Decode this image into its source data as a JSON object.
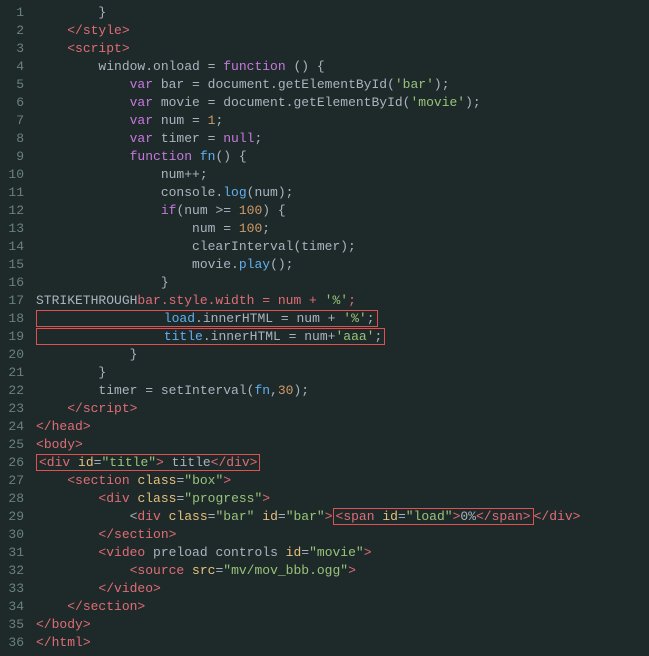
{
  "lines": [
    {
      "num": 1,
      "tokens": [
        {
          "t": "        }",
          "c": "plain"
        }
      ]
    },
    {
      "num": 2,
      "tokens": [
        {
          "t": "    </",
          "c": "tag"
        },
        {
          "t": "style",
          "c": "tag"
        },
        {
          "t": ">",
          "c": "tag"
        }
      ]
    },
    {
      "num": 3,
      "tokens": [
        {
          "t": "    <",
          "c": "tag"
        },
        {
          "t": "script",
          "c": "tag"
        },
        {
          "t": ">",
          "c": "tag"
        }
      ]
    },
    {
      "num": 4,
      "tokens": [
        {
          "t": "        window.onload = ",
          "c": "plain"
        },
        {
          "t": "function",
          "c": "purple"
        },
        {
          "t": " () {",
          "c": "plain"
        }
      ]
    },
    {
      "num": 5,
      "tokens": [
        {
          "t": "            ",
          "c": "plain"
        },
        {
          "t": "var",
          "c": "purple"
        },
        {
          "t": " bar = document.getElementById(",
          "c": "plain"
        },
        {
          "t": "'bar'",
          "c": "str"
        },
        {
          "t": ");",
          "c": "plain"
        }
      ]
    },
    {
      "num": 6,
      "tokens": [
        {
          "t": "            ",
          "c": "plain"
        },
        {
          "t": "var",
          "c": "purple"
        },
        {
          "t": " movie = document.getElementById(",
          "c": "plain"
        },
        {
          "t": "'movie'",
          "c": "str"
        },
        {
          "t": ");",
          "c": "plain"
        }
      ]
    },
    {
      "num": 7,
      "tokens": [
        {
          "t": "            ",
          "c": "plain"
        },
        {
          "t": "var",
          "c": "purple"
        },
        {
          "t": " num = ",
          "c": "plain"
        },
        {
          "t": "1",
          "c": "num"
        },
        {
          "t": ";",
          "c": "plain"
        }
      ]
    },
    {
      "num": 8,
      "tokens": [
        {
          "t": "            ",
          "c": "plain"
        },
        {
          "t": "var",
          "c": "purple"
        },
        {
          "t": " timer = ",
          "c": "plain"
        },
        {
          "t": "null",
          "c": "purple"
        },
        {
          "t": ";",
          "c": "plain"
        }
      ]
    },
    {
      "num": 9,
      "tokens": [
        {
          "t": "            ",
          "c": "plain"
        },
        {
          "t": "function",
          "c": "purple"
        },
        {
          "t": " ",
          "c": "plain"
        },
        {
          "t": "fn",
          "c": "blue"
        },
        {
          "t": "() {",
          "c": "plain"
        }
      ]
    },
    {
      "num": 10,
      "tokens": [
        {
          "t": "                num++;",
          "c": "plain"
        }
      ]
    },
    {
      "num": 11,
      "tokens": [
        {
          "t": "                console.",
          "c": "plain"
        },
        {
          "t": "log",
          "c": "blue"
        },
        {
          "t": "(num);",
          "c": "plain"
        }
      ]
    },
    {
      "num": 12,
      "tokens": [
        {
          "t": "                ",
          "c": "plain"
        },
        {
          "t": "if",
          "c": "purple"
        },
        {
          "t": "(num >= ",
          "c": "plain"
        },
        {
          "t": "100",
          "c": "num"
        },
        {
          "t": ") {",
          "c": "plain"
        }
      ]
    },
    {
      "num": 13,
      "tokens": [
        {
          "t": "                    num = ",
          "c": "plain"
        },
        {
          "t": "100",
          "c": "num"
        },
        {
          "t": ";",
          "c": "plain"
        }
      ]
    },
    {
      "num": 14,
      "tokens": [
        {
          "t": "                    clearInterval(timer);",
          "c": "plain"
        }
      ]
    },
    {
      "num": 15,
      "tokens": [
        {
          "t": "                    movie.",
          "c": "plain"
        },
        {
          "t": "play",
          "c": "blue"
        },
        {
          "t": "();",
          "c": "plain"
        }
      ]
    },
    {
      "num": 16,
      "tokens": [
        {
          "t": "                }",
          "c": "plain"
        }
      ]
    },
    {
      "num": 17,
      "tokens": [
        {
          "t": "STRIKETHROUGH",
          "c": "strike"
        },
        {
          "t": "bar.style.width = num + ",
          "c": "red2"
        },
        {
          "t": "'%'",
          "c": "str2"
        },
        {
          "t": ";",
          "c": "red2"
        }
      ]
    },
    {
      "num": 18,
      "tokens": [
        {
          "t": "HIGHLIGHT",
          "c": "highlight"
        },
        {
          "t": "load",
          "c": "hl_load"
        },
        {
          "t": ".innerHTML = num + ",
          "c": "hl_plain"
        },
        {
          "t": "'%'",
          "c": "hl_str"
        },
        {
          "t": ";",
          "c": "hl_plain"
        }
      ]
    },
    {
      "num": 19,
      "tokens": [
        {
          "t": "HIGHLIGHT",
          "c": "highlight"
        },
        {
          "t": "title",
          "c": "hl_title"
        },
        {
          "t": ".innerHTML = num+",
          "c": "hl_plain"
        },
        {
          "t": "'aaa'",
          "c": "hl_str"
        },
        {
          "t": ";",
          "c": "hl_plain"
        }
      ]
    },
    {
      "num": 20,
      "tokens": [
        {
          "t": "            }",
          "c": "plain"
        }
      ]
    },
    {
      "num": 21,
      "tokens": [
        {
          "t": "        }",
          "c": "plain"
        }
      ]
    },
    {
      "num": 22,
      "tokens": [
        {
          "t": "        timer = setInterval(",
          "c": "plain"
        },
        {
          "t": "fn",
          "c": "blue"
        },
        {
          "t": ",",
          "c": "plain"
        },
        {
          "t": "30",
          "c": "num"
        },
        {
          "t": ");",
          "c": "plain"
        }
      ]
    },
    {
      "num": 23,
      "tokens": [
        {
          "t": "    </",
          "c": "tag"
        },
        {
          "t": "script",
          "c": "tag"
        },
        {
          "t": ">",
          "c": "tag"
        }
      ]
    },
    {
      "num": 24,
      "tokens": [
        {
          "t": "</",
          "c": "tag"
        },
        {
          "t": "head",
          "c": "tag"
        },
        {
          "t": ">",
          "c": "tag"
        }
      ]
    },
    {
      "num": 25,
      "tokens": [
        {
          "t": "<",
          "c": "tag"
        },
        {
          "t": "body",
          "c": "tag"
        },
        {
          "t": ">",
          "c": "tag"
        }
      ]
    },
    {
      "num": 26,
      "tokens": [
        {
          "t": "TITLE_HL",
          "c": "title_hl"
        }
      ]
    },
    {
      "num": 27,
      "tokens": [
        {
          "t": "    <",
          "c": "tag"
        },
        {
          "t": "section",
          "c": "tag"
        },
        {
          "t": " ",
          "c": "plain"
        },
        {
          "t": "class",
          "c": "attr"
        },
        {
          "t": "=",
          "c": "plain"
        },
        {
          "t": "\"box\"",
          "c": "str"
        },
        {
          "t": ">",
          "c": "tag"
        }
      ]
    },
    {
      "num": 28,
      "tokens": [
        {
          "t": "        <",
          "c": "tag"
        },
        {
          "t": "div",
          "c": "tag"
        },
        {
          "t": " ",
          "c": "plain"
        },
        {
          "t": "class",
          "c": "attr"
        },
        {
          "t": "=",
          "c": "plain"
        },
        {
          "t": "\"progress\"",
          "c": "str"
        },
        {
          "t": ">",
          "c": "tag"
        }
      ]
    },
    {
      "num": 29,
      "tokens": [
        {
          "t": "LOAD_HL",
          "c": "load_hl"
        }
      ]
    },
    {
      "num": 30,
      "tokens": [
        {
          "t": "        </",
          "c": "tag"
        },
        {
          "t": "section",
          "c": "tag"
        },
        {
          "t": ">",
          "c": "tag"
        }
      ]
    },
    {
      "num": 31,
      "tokens": [
        {
          "t": "        <",
          "c": "tag"
        },
        {
          "t": "video",
          "c": "tag"
        },
        {
          "t": " ",
          "c": "plain"
        },
        {
          "t": "preload controls ",
          "c": "plain"
        },
        {
          "t": "id",
          "c": "attr"
        },
        {
          "t": "=",
          "c": "plain"
        },
        {
          "t": "\"movie\"",
          "c": "str"
        },
        {
          "t": ">",
          "c": "tag"
        }
      ]
    },
    {
      "num": 32,
      "tokens": [
        {
          "t": "            <",
          "c": "tag"
        },
        {
          "t": "source",
          "c": "tag"
        },
        {
          "t": " ",
          "c": "plain"
        },
        {
          "t": "src",
          "c": "attr"
        },
        {
          "t": "=",
          "c": "plain"
        },
        {
          "t": "\"mv/mov_bbb.ogg\"",
          "c": "str"
        },
        {
          "t": ">",
          "c": "tag"
        }
      ]
    },
    {
      "num": 33,
      "tokens": [
        {
          "t": "        </",
          "c": "tag"
        },
        {
          "t": "video",
          "c": "tag"
        },
        {
          "t": ">",
          "c": "tag"
        }
      ]
    },
    {
      "num": 34,
      "tokens": [
        {
          "t": "    </",
          "c": "tag"
        },
        {
          "t": "section",
          "c": "tag"
        },
        {
          "t": ">",
          "c": "tag"
        }
      ]
    },
    {
      "num": 35,
      "tokens": [
        {
          "t": "</",
          "c": "tag"
        },
        {
          "t": "body",
          "c": "tag"
        },
        {
          "t": ">",
          "c": "tag"
        }
      ]
    },
    {
      "num": 36,
      "tokens": [
        {
          "t": "</",
          "c": "tag"
        },
        {
          "t": "html",
          "c": "tag"
        },
        {
          "t": ">",
          "c": "tag"
        }
      ]
    }
  ]
}
